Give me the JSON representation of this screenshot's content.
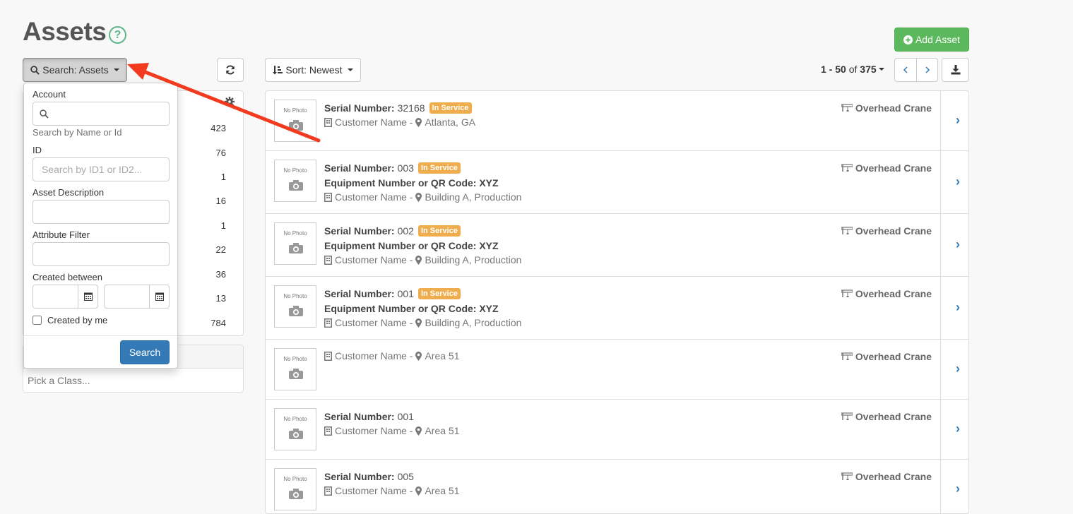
{
  "header": {
    "title": "Assets",
    "help": "?",
    "add_label": "Add Asset"
  },
  "toolbar": {
    "search_label": "Search: Assets",
    "sort_label": "Sort: Newest",
    "pager_range": "1 - 50",
    "pager_of": "of",
    "pager_total": "375"
  },
  "left_panel": {
    "counts": [
      "423",
      "76",
      "1",
      "16",
      "1",
      "22",
      "36",
      "13",
      "784"
    ],
    "class_placeholder": "Pick a Class..."
  },
  "search_dropdown": {
    "account_label": "Account",
    "account_help": "Search by Name or Id",
    "id_label": "ID",
    "id_placeholder": "Search by ID1 or ID2...",
    "description_label": "Asset Description",
    "attribute_label": "Attribute Filter",
    "created_label": "Created between",
    "created_by_me": "Created by me",
    "submit": "Search"
  },
  "assets": [
    {
      "serial_label": "Serial Number:",
      "serial": "32168",
      "status": "In Service",
      "customer": "Customer Name -",
      "location": "Atlanta, GA",
      "type": "Overhead Crane"
    },
    {
      "serial_label": "Serial Number:",
      "serial": "003",
      "status": "In Service",
      "equip_label": "Equipment Number or QR Code:",
      "equip": "XYZ",
      "customer": "Customer Name -",
      "location": "Building A, Production",
      "type": "Overhead Crane"
    },
    {
      "serial_label": "Serial Number:",
      "serial": "002",
      "status": "In Service",
      "equip_label": "Equipment Number or QR Code:",
      "equip": "XYZ",
      "customer": "Customer Name -",
      "location": "Building A, Production",
      "type": "Overhead Crane"
    },
    {
      "serial_label": "Serial Number:",
      "serial": "001",
      "status": "In Service",
      "equip_label": "Equipment Number or QR Code:",
      "equip": "XYZ",
      "customer": "Customer Name -",
      "location": "Building A, Production",
      "type": "Overhead Crane"
    },
    {
      "customer": "Customer Name -",
      "location": "Area 51",
      "type": "Overhead Crane"
    },
    {
      "serial_label": "Serial Number:",
      "serial": "001",
      "customer": "Customer Name -",
      "location": "Area 51",
      "type": "Overhead Crane"
    },
    {
      "serial_label": "Serial Number:",
      "serial": "005",
      "customer": "Customer Name -",
      "location": "Area 51",
      "type": "Overhead Crane"
    }
  ],
  "thumb_text": "No Photo",
  "colors": {
    "primary": "#337ab7",
    "success": "#5cb85c",
    "warning": "#f0ad4e",
    "annotation_arrow": "#f23a1f"
  },
  "icons": [
    "help-icon",
    "search-icon",
    "refresh-icon",
    "sort-icon",
    "plus-circle-icon",
    "chevron-left-icon",
    "chevron-right-icon",
    "download-icon",
    "gear-icon",
    "calendar-icon",
    "building-icon",
    "map-marker-icon",
    "crane-icon",
    "camera-icon"
  ]
}
